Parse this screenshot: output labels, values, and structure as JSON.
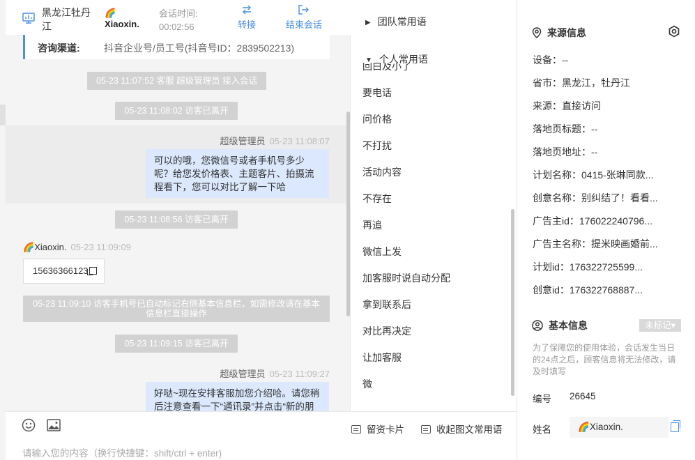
{
  "header": {
    "location": "黑龙江牡丹江",
    "visitor_name": "Xiaoxin.",
    "session_time_label": "会话时间:",
    "session_time": "00:02:56",
    "transfer_label": "转接",
    "end_session_label": "结束会话"
  },
  "chat": {
    "channel_label": "咨询渠道:",
    "channel_value": "抖音企业号/员工号(抖音号ID：2839502213)",
    "system_1": "05-23 11:07:52 客服 超级管理员 接入会话",
    "system_2": "05-23 11:08:02 访客已离开",
    "agent_msg_1": {
      "sender": "超级管理员",
      "time": "05-23 11:08:07",
      "text": "可以的哦，您微信号或者手机号多少呢？给您发价格表、主题客片、拍摄流程看下，您可以对比了解一下哈"
    },
    "system_3": "05-23 11:08:56 访客已离开",
    "visitor_msg_1": {
      "sender": "Xiaoxin.",
      "time": "05-23 11:09:09",
      "text": "15636366123"
    },
    "system_4": "05-23 11:09:10 访客手机号已自动标记右侧基本信息栏，如需修改请在基本信息栏直接操作",
    "system_5": "05-23 11:09:15 访客已离开",
    "agent_msg_2": {
      "sender": "超级管理员",
      "time": "05-23 11:09:27",
      "text": "好哒~现在安排客服加您介绍哈。请您稍后注意查看一下“通讯录”并点击“新的朋"
    }
  },
  "composer": {
    "placeholder": "请输入您的内容（换行快捷键：shift/ctrl + enter)"
  },
  "phrases": {
    "team_group": "团队常用语",
    "personal_group": "个人常用语",
    "items": [
      "要电话",
      "问价格",
      "不打扰",
      "活动内容",
      "不存在",
      "再追",
      "微信上发",
      "加客服时说自动分配",
      "拿到联系后",
      "对比再决定",
      "让加客服",
      "微"
    ],
    "clipped_item": "回白及小了",
    "card_button": "留资卡片",
    "collapse_button": "收起图文常用语"
  },
  "source_info": {
    "title": "来源信息",
    "device": "设备：--",
    "province_city": "省市：黑龙江，牡丹江",
    "source": "来源：直接访问",
    "landing_title": "落地页标题：--",
    "landing_url": "落地页地址：--",
    "plan_name": "计划名称：0415-张琳同款...",
    "creative_name": "创意名称：别纠结了！看看...",
    "advertiser_id": "广告主id：176022240796...",
    "advertiser_name": "广告主名称：提米映画婚前...",
    "plan_id": "计划id：176322725599...",
    "creative_id": "创意id：176322768887..."
  },
  "basic_info": {
    "title": "基本信息",
    "tag": "未标记",
    "notice": "为了保障您的使用体验，会话发生当日的24点之后，顾客信息将无法修改，请及时填写",
    "id_label": "编号",
    "id_value": "26645",
    "name_label": "姓名",
    "name_value": "Xiaoxin."
  },
  "colors": {
    "accent": "#4a90e2",
    "agent_bubble": "#dbe8fd",
    "system_bar": "#d2d2d2"
  }
}
